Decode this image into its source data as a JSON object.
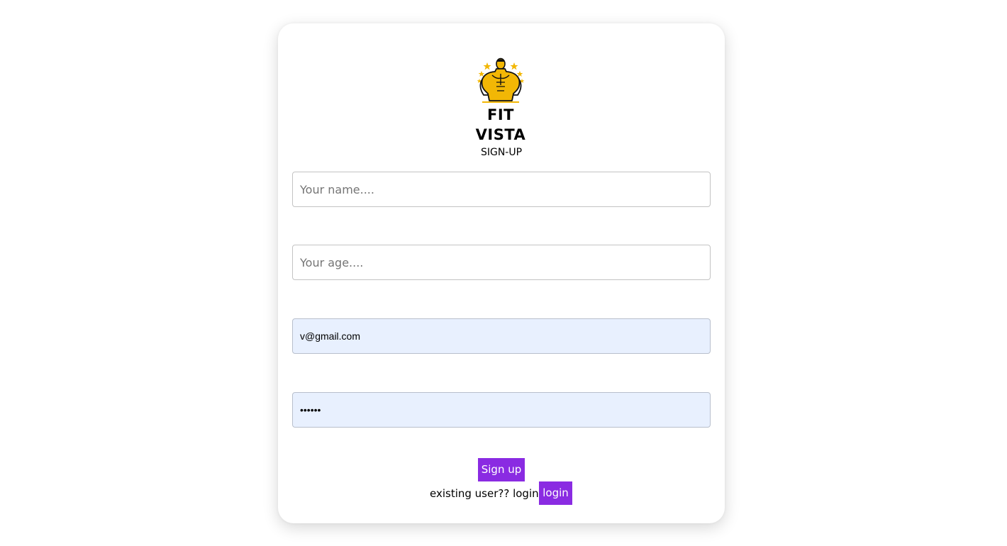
{
  "brand": {
    "name": "FIT VISTA",
    "logo_icon": "bodybuilder-logo-icon",
    "accent_color": "#f2b705"
  },
  "form": {
    "heading": "SIGN-UP",
    "name": {
      "value": "",
      "placeholder": "Your name...."
    },
    "age": {
      "value": "",
      "placeholder": "Your age...."
    },
    "email": {
      "value": "v@gmail.com",
      "placeholder": ""
    },
    "password": {
      "value": "••••••",
      "placeholder": ""
    },
    "submit_label": "Sign up"
  },
  "footer": {
    "existing_text": "existing user?? login",
    "login_label": "login"
  },
  "colors": {
    "button_bg": "#8a2be2",
    "autofill_bg": "#e8f0fe"
  }
}
